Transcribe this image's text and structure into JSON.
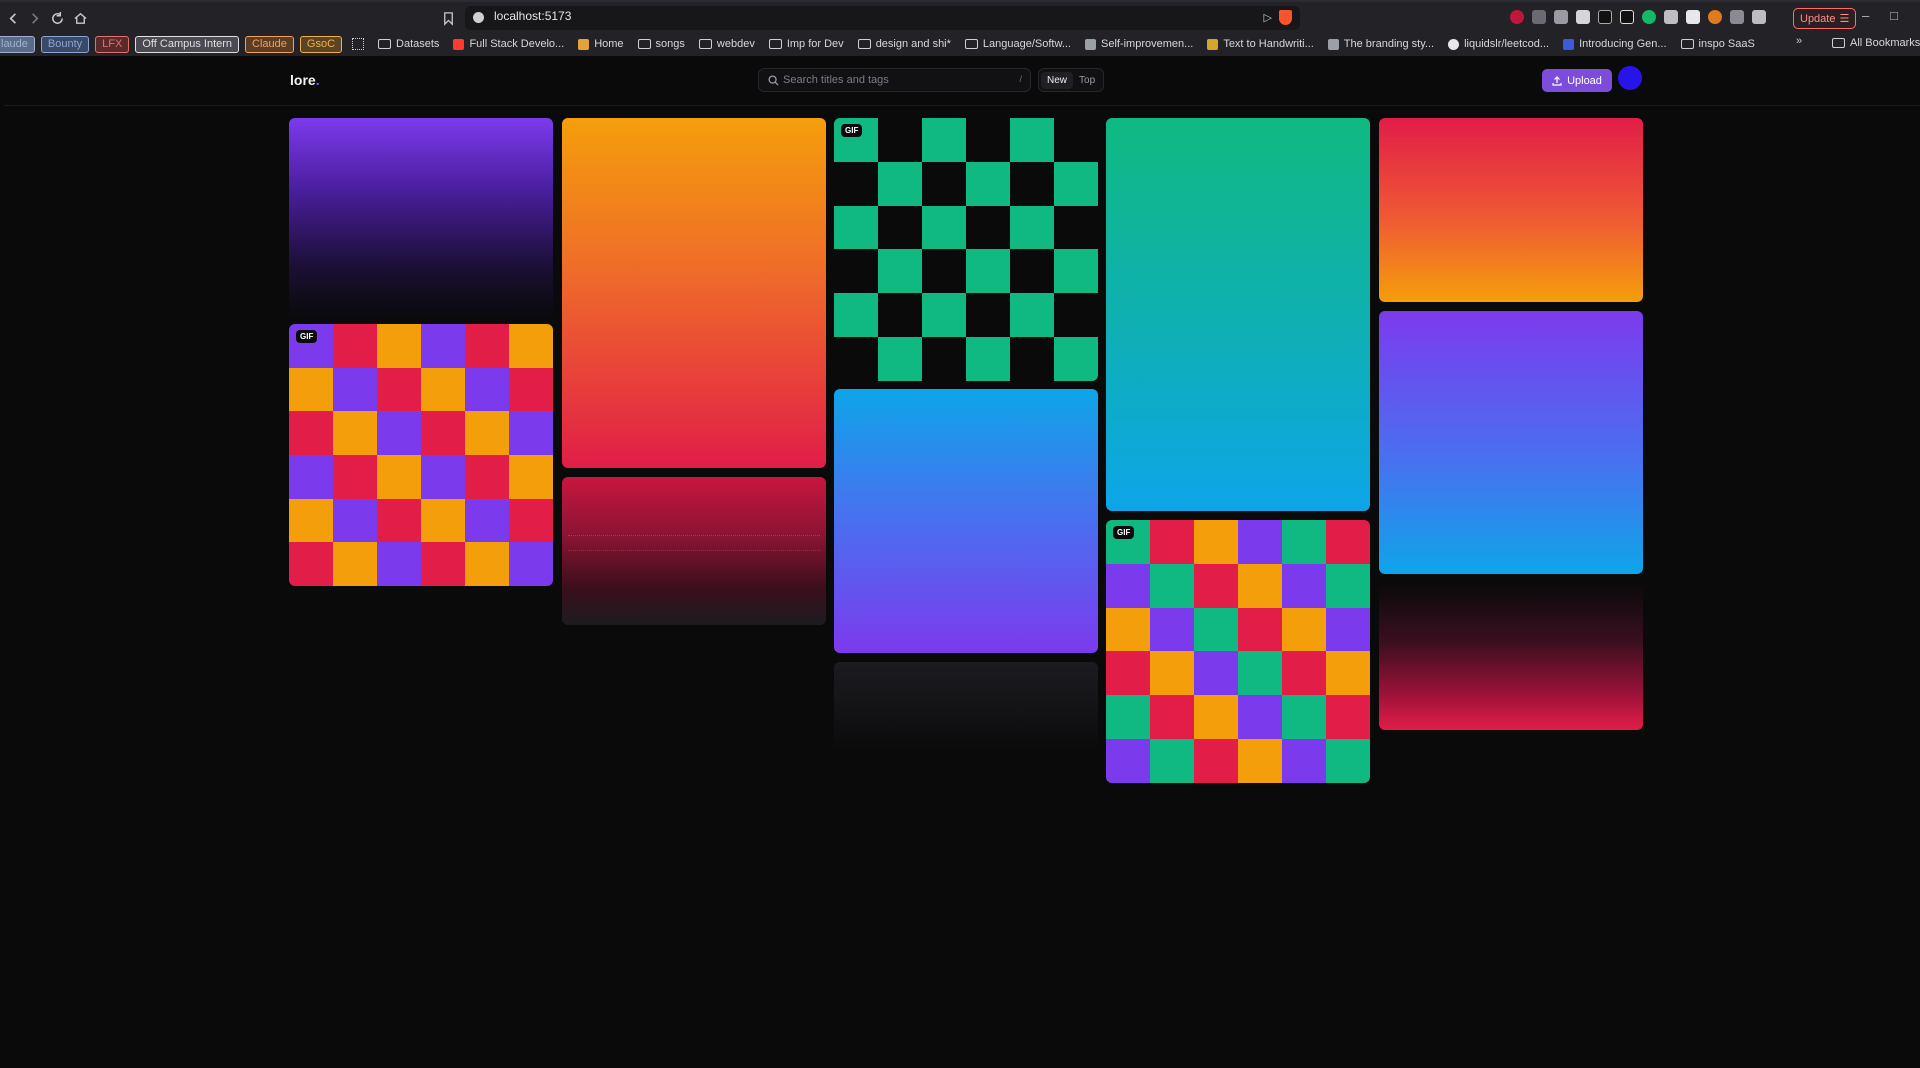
{
  "browser": {
    "url": "localhost:5173",
    "update_label": "Update"
  },
  "bookmarks": {
    "chips": [
      {
        "label": "laude",
        "color": "#5b6b8a",
        "text": "#9fb0d0"
      },
      {
        "label": "Bounty",
        "color": "#3a4a66",
        "text": "#8aa4d4"
      },
      {
        "label": "LFX",
        "color": "#5a2a2a",
        "text": "#e07070"
      },
      {
        "label": "Off Campus Intern",
        "color": "#4a4a52",
        "text": "#e0e0e0"
      },
      {
        "label": "Claude",
        "color": "#5a3d22",
        "text": "#f0a060"
      },
      {
        "label": "GsoC",
        "color": "#5a4422",
        "text": "#f0b050"
      }
    ],
    "items": [
      {
        "label": "Datasets",
        "icon": "folder-icon"
      },
      {
        "label": "Full Stack Develo...",
        "icon": "favicon"
      },
      {
        "label": "Home",
        "icon": "favicon"
      },
      {
        "label": "songs",
        "icon": "folder-icon"
      },
      {
        "label": "webdev",
        "icon": "folder-icon"
      },
      {
        "label": "Imp for Dev",
        "icon": "folder-icon"
      },
      {
        "label": "design and shi*",
        "icon": "folder-icon"
      },
      {
        "label": "Language/Softw...",
        "icon": "folder-icon"
      },
      {
        "label": "Self-improvemen...",
        "icon": "favicon"
      },
      {
        "label": "Text to Handwriti...",
        "icon": "favicon"
      },
      {
        "label": "The branding sty...",
        "icon": "favicon"
      },
      {
        "label": "liquidslr/leetcod...",
        "icon": "github-icon"
      },
      {
        "label": "Introducing Gen...",
        "icon": "favicon"
      },
      {
        "label": "inspo SaaS",
        "icon": "folder-icon"
      }
    ],
    "all_bookmarks": "All Bookmarks"
  },
  "app": {
    "logo": "lore",
    "logo_dot": ".",
    "search_placeholder": "Search titles and tags",
    "search_shortcut": "/",
    "sort_new": "New",
    "sort_top": "Top",
    "upload_label": "Upload",
    "gif_badge": "GIF"
  },
  "colors": {
    "purple": "#7c3aed",
    "orange": "#f59e0b",
    "red": "#e11d48",
    "green": "#10b981",
    "blue": "#0ea5e9",
    "accent": "#7c4ddb"
  }
}
